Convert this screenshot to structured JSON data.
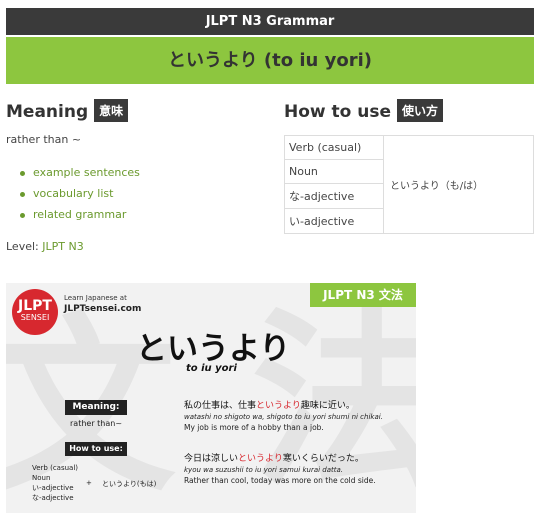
{
  "header": {
    "title": "JLPT N3 Grammar",
    "grammar_point": "というより (to iu yori)"
  },
  "meaning": {
    "title": "Meaning",
    "badge": "意味",
    "text": "rather than ~",
    "links": [
      "example sentences",
      "vocabulary list",
      "related grammar"
    ],
    "level_label": "Level:",
    "level_link": "JLPT N3"
  },
  "how_to_use": {
    "title": "How to use",
    "badge": "使い方",
    "forms": [
      "Verb (casual)",
      "Noun",
      "な-adjective",
      "い-adjective"
    ],
    "pattern": "というより（も/は）"
  },
  "card": {
    "ribbon": "JLPT N3 文法",
    "logo_top": "JLPT",
    "logo_bottom": "SENSEI",
    "learn": "Learn Japanese at",
    "site": "JLPTsensei.com",
    "big": "というより",
    "romaji": "to iu yori",
    "meaning_label": "Meaning:",
    "meaning_value": "rather than~",
    "howto_label": "How to use:",
    "forms": [
      "Verb (casual)",
      "Noun",
      "い-adjective",
      "な-adjective"
    ],
    "plus": "+",
    "pattern": "というより(もは)",
    "bg_left": "文",
    "bg_right": "法",
    "ex1": {
      "jp_before": "私の仕事は、仕事",
      "jp_hl": "というより",
      "jp_after": "趣味に近い。",
      "romaji": "watashi no shigoto wa, shigoto to iu yori shumi ni chikai.",
      "en": "My job is more of a hobby than a job."
    },
    "ex2": {
      "jp_before": "今日は涼しい",
      "jp_hl": "というより",
      "jp_after": "寒いくらいだった。",
      "romaji": "kyou wa suzushii to iu yori samui kurai datta.",
      "en": "Rather than cool, today was more on the cold side."
    }
  }
}
